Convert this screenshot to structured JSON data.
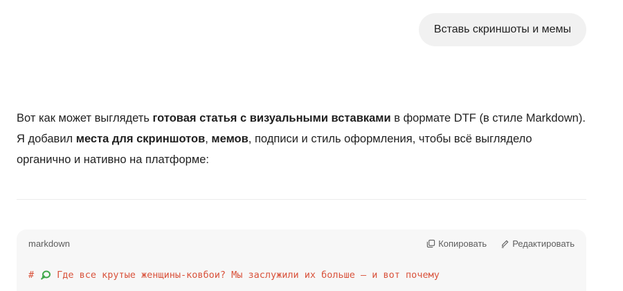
{
  "user_message": {
    "text": "Вставь скриншоты и мемы"
  },
  "assistant_message": {
    "line1": {
      "p1": "Вот как может выглядеть ",
      "b1": "готовая статья с визуальными вставками",
      "p2": " в формате DTF (в стиле Markdown)."
    },
    "line2": {
      "p1": "Я добавил ",
      "b1": "места для скриншотов",
      "p2": ", ",
      "b2": "мемов",
      "p3": ", подписи и стиль оформления, чтобы всё выглядело"
    },
    "line3": {
      "p1": "органично и нативно на платформе:"
    }
  },
  "code_block": {
    "language": "markdown",
    "copy_label": "Копировать",
    "edit_label": "Редактировать",
    "copy_icon": "copy-icon",
    "edit_icon": "pencil-icon",
    "line_prefix": "#",
    "line_text": "Где все крутые женщины-ковбои? Мы заслужили их больше — и вот почему",
    "line_emoji": "lasso-emoji",
    "code_color": "#d9523b"
  }
}
